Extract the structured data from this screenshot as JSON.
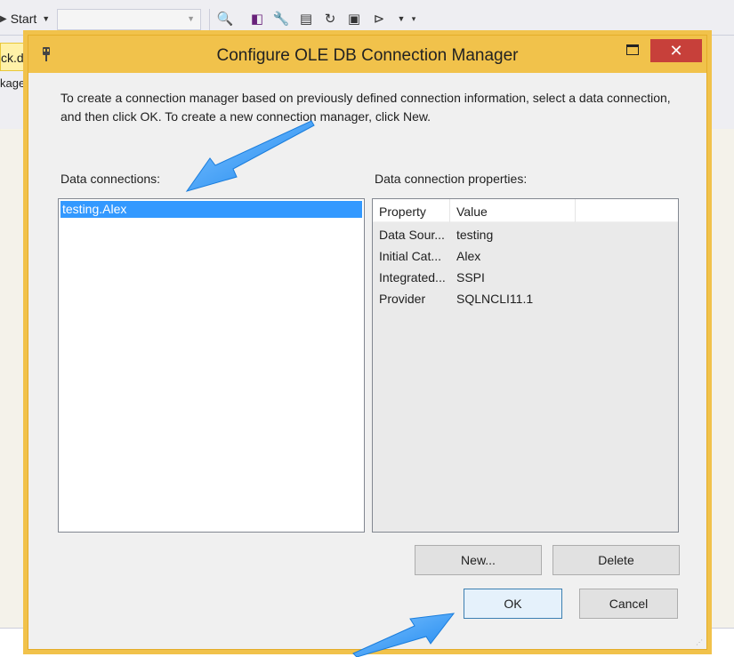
{
  "ide": {
    "start_label": "Start",
    "doc_tab_label": "ck.dtsx",
    "doc_sub_label": "kage Explorer"
  },
  "dialog": {
    "title": "Configure OLE DB Connection Manager",
    "description": "To create a connection manager based on previously defined connection information, select a data connection, and then click OK. To create a new connection manager, click New.",
    "data_connections_label": "Data connections:",
    "connections": [
      "testing.Alex"
    ],
    "properties_label": "Data connection properties:",
    "properties_columns": [
      "Property",
      "Value"
    ],
    "properties": [
      {
        "property": "Data Sour...",
        "value": "testing"
      },
      {
        "property": "Initial Cat...",
        "value": "Alex"
      },
      {
        "property": "Integrated...",
        "value": "SSPI"
      },
      {
        "property": "Provider",
        "value": "SQLNCLI11.1"
      }
    ],
    "buttons": {
      "new": "New...",
      "delete": "Delete",
      "ok": "OK",
      "cancel": "Cancel"
    }
  },
  "colors": {
    "title_bar": "#f1c24b",
    "close_button": "#c7403a",
    "selection": "#3399ff",
    "annotation_arrow": "#2a8ef0"
  }
}
